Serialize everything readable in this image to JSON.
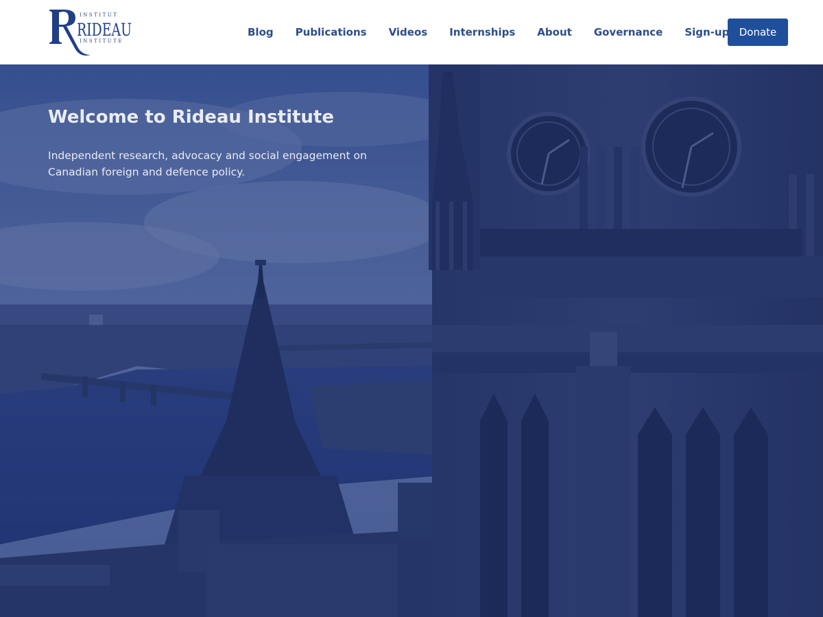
{
  "logo": {
    "top_text": "INSTITUT",
    "main_text": "RIDEAU",
    "bottom_text": "INSTITUTE"
  },
  "nav": {
    "items": [
      "Blog",
      "Publications",
      "Videos",
      "Internships",
      "About",
      "Governance",
      "Sign-up"
    ],
    "donate": "Donate"
  },
  "hero": {
    "title": "Welcome to Rideau Institute",
    "subtitle": "Independent research, advocacy and social engagement on Canadian foreign and defence policy."
  },
  "colors": {
    "brand": "#1f3f87",
    "nav_text": "#2d4e8a",
    "button": "#1f4e9b",
    "overlay": "#1c306e"
  }
}
